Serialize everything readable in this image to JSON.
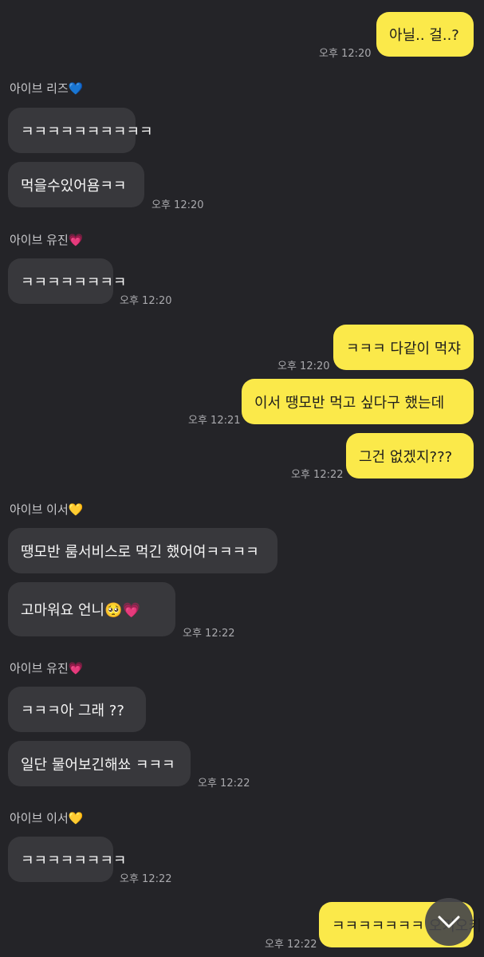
{
  "messages": {
    "m1": {
      "text": "아닐.. 걸..?",
      "time": "오후 12:20"
    },
    "s1": {
      "name": "아이브 리즈💙"
    },
    "m2": {
      "text": "ㅋㅋㅋㅋㅋㅋㅋㅋㅋㅋ"
    },
    "m3": {
      "text": "먹을수있어욤ㅋㅋ",
      "time": "오후 12:20"
    },
    "s2": {
      "name": "아이브 유진💗"
    },
    "m4": {
      "text": "ㅋㅋㅋㅋㅋㅋㅋㅋ",
      "time": "오후 12:20"
    },
    "m5": {
      "text": "ㅋㅋㅋ 다같이 먹쟈",
      "time": "오후 12:20"
    },
    "m6": {
      "text": "이서 땡모반 먹고 싶다구 했는데",
      "time": "오후 12:21"
    },
    "m7": {
      "text": "그건 없겠지???",
      "time": "오후 12:22"
    },
    "s3": {
      "name": "아이브 이서💛"
    },
    "m8": {
      "text": "땡모반 룸서비스로 먹긴 했어여ㅋㅋㅋㅋ"
    },
    "m9": {
      "text": "고마워요 언니🥺💗",
      "time": "오후 12:22"
    },
    "s4": {
      "name": "아이브 유진💗"
    },
    "m10": {
      "text": "ㅋㅋㅋ아 그래 ??"
    },
    "m11": {
      "text": "일단 물어보긴해쑈 ㅋㅋㅋ",
      "time": "오후 12:22"
    },
    "s5": {
      "name": "아이브 이서💛"
    },
    "m12": {
      "text": "ㅋㅋㅋㅋㅋㅋㅋㅋ",
      "time": "오후 12:22"
    },
    "m13": {
      "text": "ㅋㅋㅋㅋㅋㅋㅋ 오키오키",
      "time": "오후 12:22"
    }
  },
  "icons": {
    "scroll_down": "chevron-down-icon"
  },
  "colors": {
    "background": "#242428",
    "incoming_bubble": "#38383c",
    "outgoing_bubble": "#fbe94a"
  }
}
